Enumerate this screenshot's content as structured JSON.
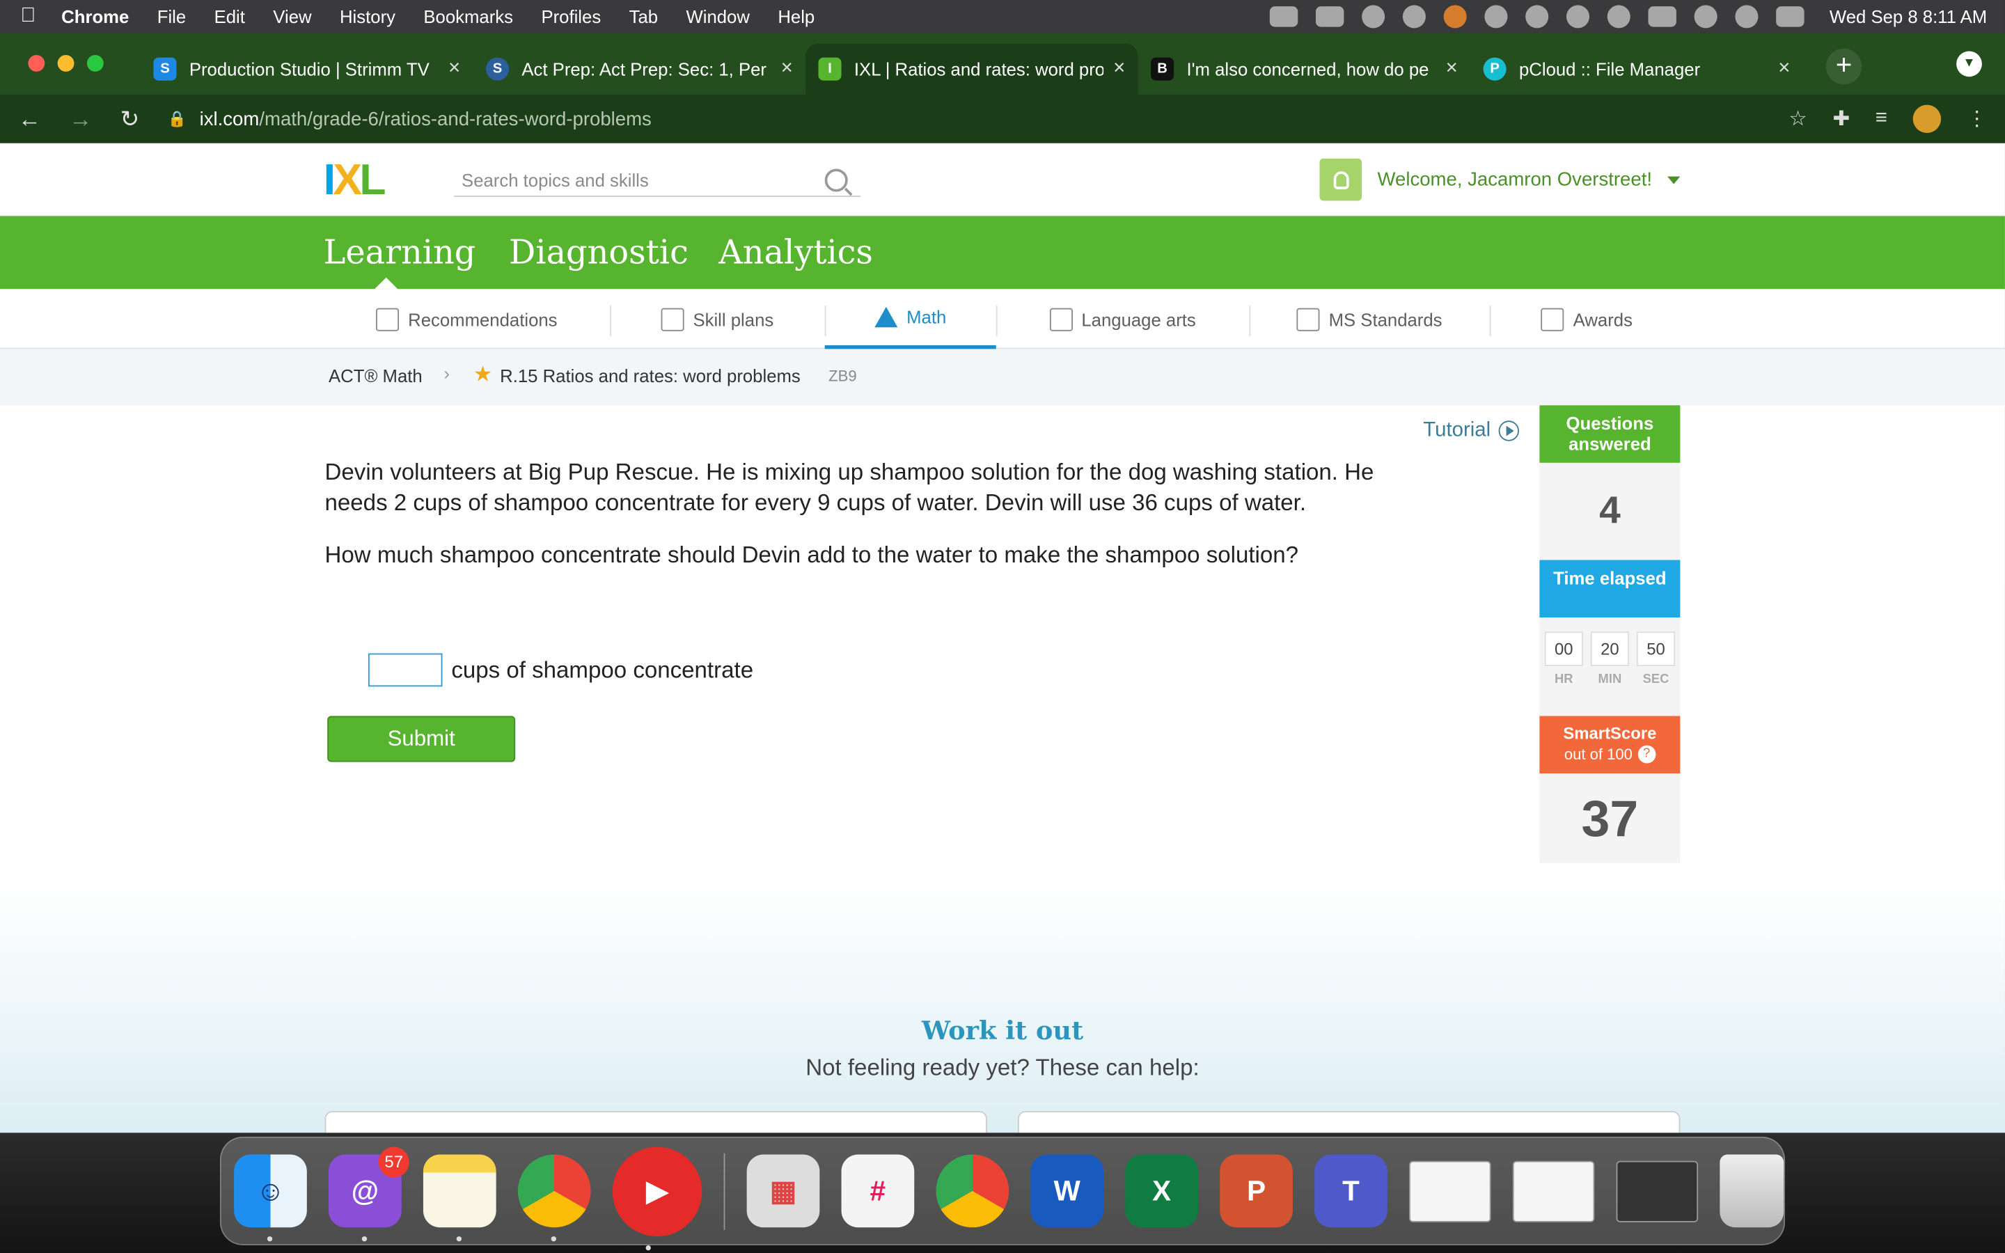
{
  "menubar": {
    "app": "Chrome",
    "items": [
      "File",
      "Edit",
      "View",
      "History",
      "Bookmarks",
      "Profiles",
      "Tab",
      "Window",
      "Help"
    ],
    "clock": "Wed Sep 8  8:11 AM"
  },
  "tabs": [
    {
      "title": "Production Studio | Strimm TV",
      "favicon": "strimm-icon",
      "color": "#1e88e5"
    },
    {
      "title": "Act Prep: Act Prep: Sec: 1, Per",
      "favicon": "schoology-icon",
      "color": "#2b5f9e"
    },
    {
      "title": "IXL | Ratios and rates: word pro",
      "favicon": "ixl-icon",
      "color": "#56b42e"
    },
    {
      "title": "I'm also concerned, how do pe",
      "favicon": "brainly-icon",
      "color": "#111111"
    },
    {
      "title": "pCloud :: File Manager",
      "favicon": "pcloud-icon",
      "color": "#17bed0"
    }
  ],
  "address": {
    "domain": "ixl.com",
    "path": "/math/grade-6/ratios-and-rates-word-problems"
  },
  "ixl": {
    "search_placeholder": "Search topics and skills",
    "welcome": "Welcome, Jacamron Overstreet!",
    "main_tabs": [
      "Learning",
      "Diagnostic",
      "Analytics"
    ],
    "subnav": [
      "Recommendations",
      "Skill plans",
      "Math",
      "Language arts",
      "MS Standards",
      "Awards"
    ],
    "breadcrumb": {
      "parent": "ACT® Math",
      "skill": "R.15 Ratios and rates: word problems",
      "code": "ZB9"
    },
    "tutorial": "Tutorial",
    "question": {
      "p1": "Devin volunteers at Big Pup Rescue. He is mixing up shampoo solution for the dog washing station. He needs 2 cups of shampoo concentrate for every 9 cups of water. Devin will use 36 cups of water.",
      "p2": "How much shampoo concentrate should Devin add to the water to make the shampoo solution?",
      "answer_suffix": "cups of shampoo concentrate",
      "answer_value": "",
      "submit": "Submit"
    },
    "sidebar": {
      "questions_answered_label": "Questions answered",
      "questions_answered": "4",
      "time_elapsed_label": "Time elapsed",
      "time": {
        "hr": "00",
        "min": "20",
        "sec": "50"
      },
      "time_units": {
        "hr": "HR",
        "min": "MIN",
        "sec": "SEC"
      },
      "smartscore_label": "SmartScore",
      "smartscore_sub": "out of 100",
      "smartscore": "37"
    },
    "workout": {
      "title": "Work it out",
      "subtitle": "Not feeling ready yet? These can help:"
    }
  },
  "dock": {
    "mail_badge": "57"
  }
}
